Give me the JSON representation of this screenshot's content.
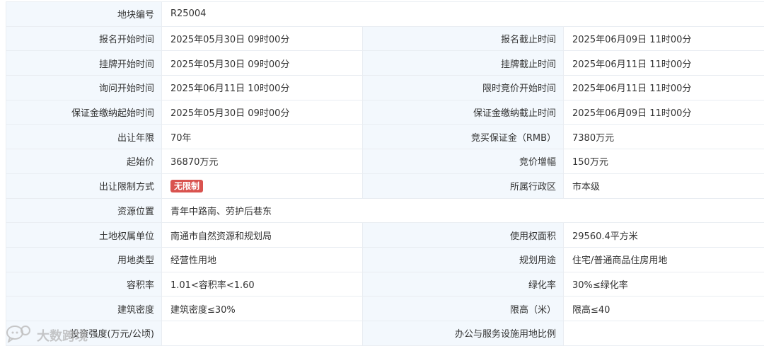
{
  "rows": [
    {
      "l1": "地块编号",
      "v1": "R25004"
    },
    {
      "l1": "报名开始时间",
      "v1": "2025年05月30日 09时00分",
      "l2": "报名截止时间",
      "v2": "2025年06月09日 11时00分"
    },
    {
      "l1": "挂牌开始时间",
      "v1": "2025年05月30日 09时00分",
      "l2": "挂牌截止时间",
      "v2": "2025年06月11日 11时00分"
    },
    {
      "l1": "询问开始时间",
      "v1": "2025年06月11日 10时00分",
      "l2": "限时竞价开始时间",
      "v2": "2025年06月11日 11时00分"
    },
    {
      "l1": "保证金缴纳起始时间",
      "v1": "2025年05月30日 09时00分",
      "l2": "保证金缴纳截止时间",
      "v2": "2025年06月09日 11时00分"
    },
    {
      "l1": "出让年限",
      "v1": "70年",
      "l2": "竞买保证金（RMB）",
      "v2": "7380万元"
    },
    {
      "l1": "起始价",
      "v1": "36870万元",
      "l2": "竞价增幅",
      "v2": "150万元"
    },
    {
      "l1": "出让限制方式",
      "badge": "无限制",
      "l2": "所属行政区",
      "v2": "市本级"
    },
    {
      "l1": "资源位置",
      "v1": "青年中路南、劳护后巷东"
    },
    {
      "l1": "土地权属单位",
      "v1": "南通市自然资源和规划局",
      "l2": "使用权面积",
      "v2": "29560.4平方米"
    },
    {
      "l1": "用地类型",
      "v1": "经营性用地",
      "l2": "规划用途",
      "v2": "住宅/普通商品住房用地"
    },
    {
      "l1": "容积率",
      "v1": "1.01<容积率<1.60",
      "l2": "绿化率",
      "v2": "30%≤绿化率"
    },
    {
      "l1": "建筑密度",
      "v1": "建筑密度≤30%",
      "l2": "限高（米）",
      "v2": "限高≤40"
    },
    {
      "l1": "投资强度(万元/公顷)",
      "v1": "",
      "l2": "办公与服务设施用地比例",
      "v2": ""
    }
  ],
  "watermark": {
    "text": "大数跨境",
    "icon": "chat-bubble-logo-icon"
  },
  "colors": {
    "label_bg": "#f3f8fd",
    "border": "#e9edf2",
    "badge_bg": "#d9534f"
  }
}
